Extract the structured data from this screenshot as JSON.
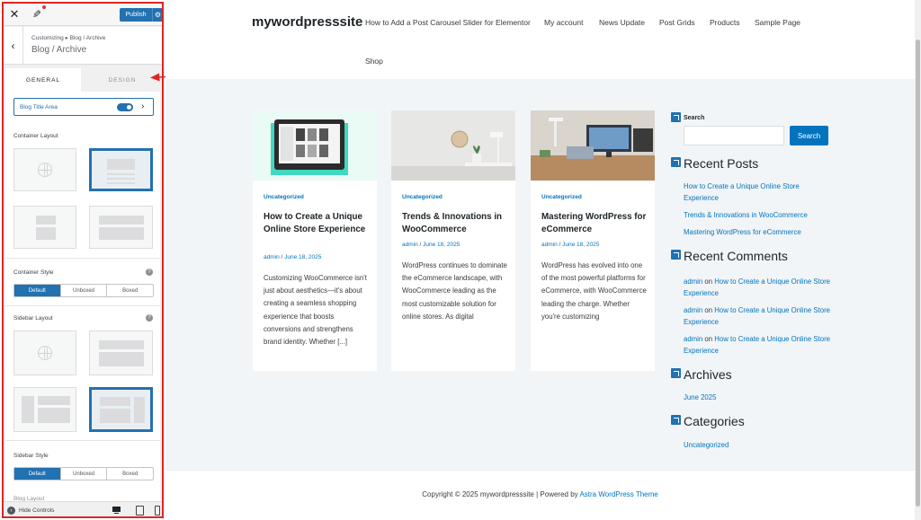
{
  "customizer": {
    "publish_label": "Publish",
    "breadcrumb": "Customizing ▸ Blog / Archive",
    "section_title": "Blog / Archive",
    "tabs": [
      "GENERAL",
      "DESIGN"
    ],
    "active_tab": "GENERAL",
    "toggle": {
      "label": "Blog Title Area",
      "enabled": true
    },
    "container_layout_label": "Container Layout",
    "container_style": {
      "label": "Container Style",
      "options": [
        "Default",
        "Unboxed",
        "Boxed"
      ],
      "selected": "Default"
    },
    "sidebar_layout_label": "Sidebar Layout",
    "sidebar_style": {
      "label": "Sidebar Style",
      "options": [
        "Default",
        "Unboxed",
        "Boxed"
      ],
      "selected": "Default"
    },
    "cut_label": "Blog Layout",
    "hide_controls_label": "Hide Controls",
    "accent_color": "#2271b1"
  },
  "site": {
    "name": "mywordpresssite",
    "nav": [
      "How to Add a Post Carousel Slider for Elementor",
      "My account",
      "News Update",
      "Post Grids",
      "Products",
      "Sample Page",
      "Shop"
    ],
    "posts": [
      {
        "category": "Uncategorized",
        "title": "How to Create a Unique Online Store Experience",
        "author": "admin",
        "date": "June 18, 2025",
        "excerpt": "Customizing WooCommerce isn't just about aesthetics—it's about creating a seamless shopping experience that boosts conversions and strengthens brand identity. Whether [...]"
      },
      {
        "category": "Uncategorized",
        "title": "Trends & Innovations in WooCommerce",
        "author": "admin",
        "date": "June 18, 2025",
        "excerpt": "WordPress continues to dominate the eCommerce landscape, with WooCommerce leading as the most customizable solution for online stores. As digital"
      },
      {
        "category": "Uncategorized",
        "title": "Mastering WordPress for eCommerce",
        "author": "admin",
        "date": "June 18, 2025",
        "excerpt": "WordPress has evolved into one of the most powerful platforms for eCommerce, with WooCommerce leading the charge. Whether you're customizing"
      }
    ],
    "sidebar": {
      "search_label": "Search",
      "search_button": "Search",
      "recent_posts_title": "Recent Posts",
      "recent_posts": [
        "How to Create a Unique Online Store Experience",
        "Trends & Innovations in WooCommerce",
        "Mastering WordPress for eCommerce"
      ],
      "recent_comments_title": "Recent Comments",
      "recent_comments": [
        {
          "author": "admin",
          "on": "on",
          "post": "How to Create a Unique Online Store Experience"
        },
        {
          "author": "admin",
          "on": "on",
          "post": "How to Create a Unique Online Store Experience"
        },
        {
          "author": "admin",
          "on": "on",
          "post": "How to Create a Unique Online Store Experience"
        }
      ],
      "archives_title": "Archives",
      "archives": [
        "June 2025"
      ],
      "categories_title": "Categories",
      "categories": [
        "Uncategorized"
      ]
    },
    "footer": {
      "prefix": "Copyright © 2025 mywordpresssite | Powered by",
      "link": "Astra WordPress Theme"
    },
    "link_color": "#0274be"
  }
}
